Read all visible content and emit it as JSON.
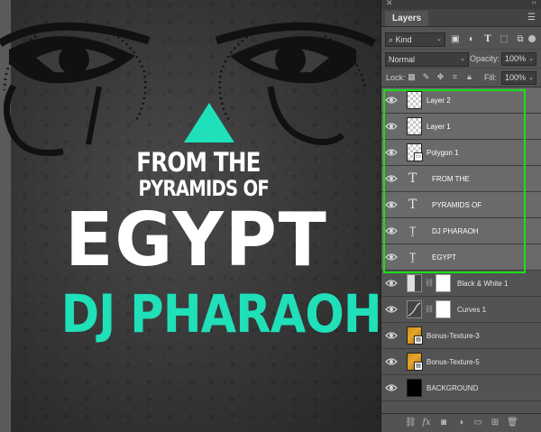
{
  "artwork": {
    "line1": "FROM THE",
    "line2": "PYRAMIDS OF",
    "line3": "EGYPT",
    "line4": "DJ PHARAOH",
    "accent_color": "#1fe0b8",
    "text_color": "#ffffff"
  },
  "panel": {
    "close_icon": "close-icon",
    "collapse_icon": "double-chevron-icon",
    "tab_label": "Layers",
    "menu_icon": "hamburger-menu-icon",
    "filter": {
      "kind_label": "Kind",
      "icons": [
        "image-filter-icon",
        "adjustment-filter-icon",
        "type-filter-icon",
        "shape-filter-icon",
        "smart-object-filter-icon"
      ],
      "toggle_icon": "filter-toggle-icon"
    },
    "blend_mode": "Normal",
    "opacity_label": "Opacity:",
    "opacity_value": "100%",
    "lock_label": "Lock:",
    "lock_icons": [
      "lock-pixels-icon",
      "lock-image-icon",
      "lock-position-icon",
      "lock-artboard-icon",
      "lock-all-icon"
    ],
    "fill_label": "Fill:",
    "fill_value": "100%",
    "layers": [
      {
        "name": "Layer 2",
        "kind": "pixel",
        "selected": true
      },
      {
        "name": "Layer 1",
        "kind": "pixel",
        "selected": true
      },
      {
        "name": "Polygon 1",
        "kind": "shape",
        "selected": true
      },
      {
        "name": "FROM THE",
        "kind": "type",
        "selected": true
      },
      {
        "name": "PYRAMIDS OF",
        "kind": "type",
        "selected": true
      },
      {
        "name": "DJ PHARAOH",
        "kind": "warped-type",
        "selected": true
      },
      {
        "name": "EGYPT",
        "kind": "warped-type",
        "selected": true
      },
      {
        "name": "Black & White 1",
        "kind": "adjustment",
        "selected": false
      },
      {
        "name": "Curves 1",
        "kind": "adjustment",
        "selected": false
      },
      {
        "name": "Bonus-Texture-3",
        "kind": "smart-object",
        "selected": false
      },
      {
        "name": "Bonus-Texture-5",
        "kind": "smart-object",
        "selected": false
      },
      {
        "name": "BACKGROUND",
        "kind": "pixel-black",
        "selected": false
      }
    ],
    "bottom_icons": [
      "link-layers-icon",
      "fx-icon",
      "add-mask-icon",
      "adjustment-layer-icon",
      "new-group-icon",
      "new-layer-icon",
      "delete-icon"
    ],
    "fx_label": "fx"
  },
  "colors": {
    "highlight": "#18e018",
    "panel_bg": "#535353",
    "selected_row": "#6a6a6a"
  }
}
